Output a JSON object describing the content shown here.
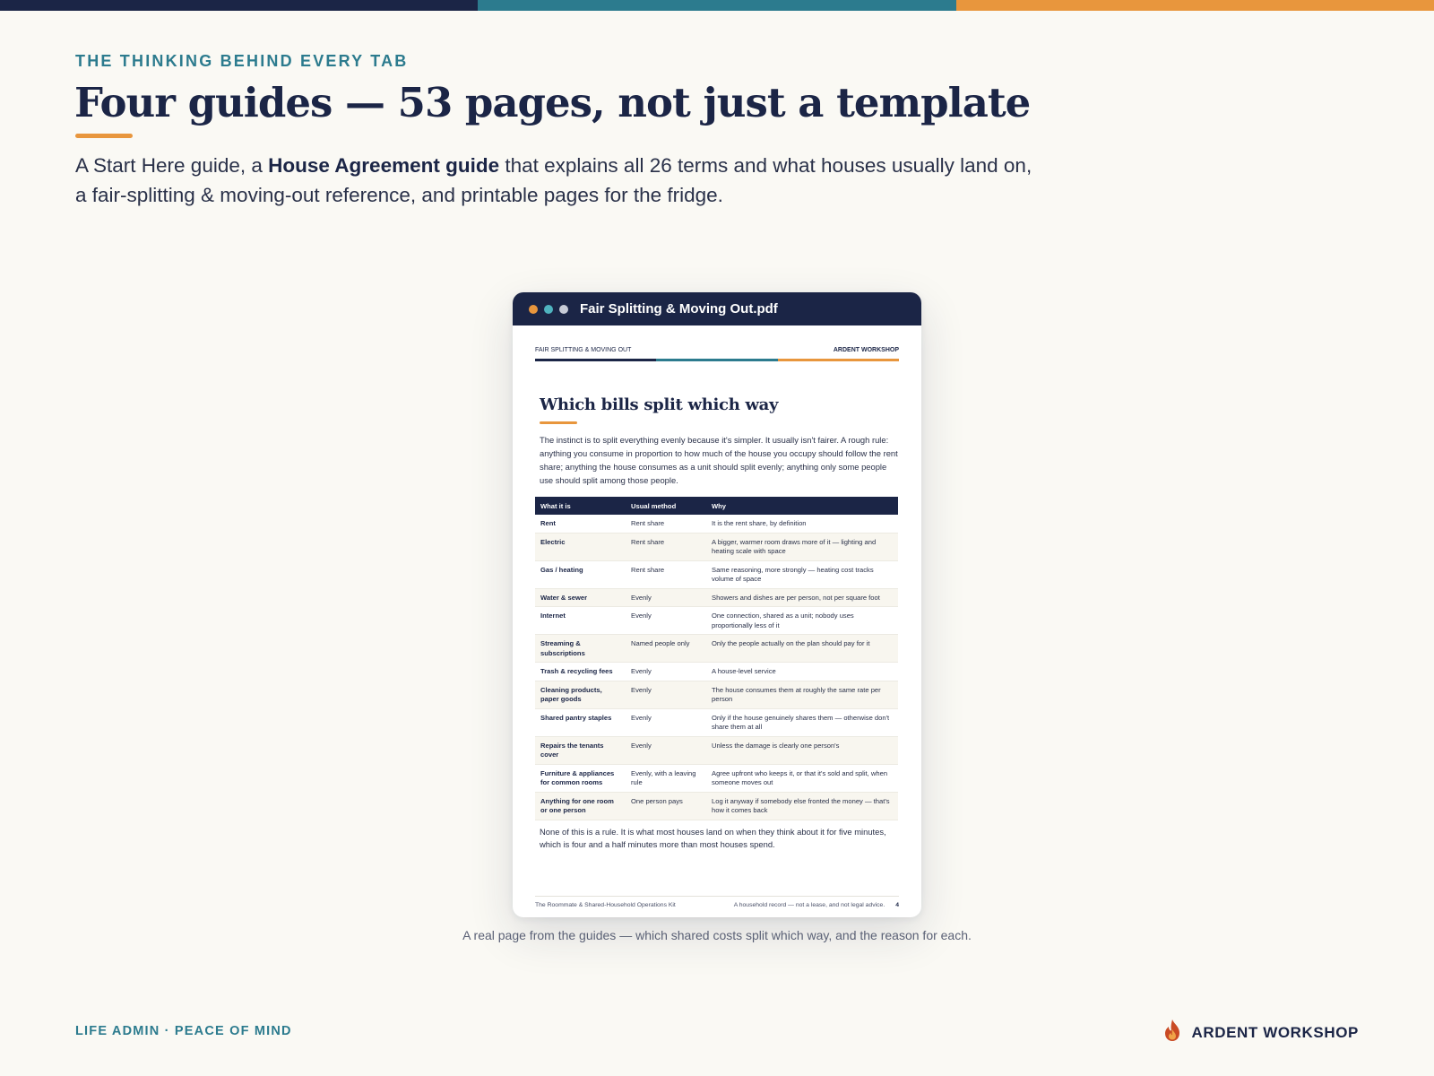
{
  "colors": {
    "navy": "#1b2546",
    "teal": "#2c7b8e",
    "orange": "#e8963d",
    "cream": "#faf9f4"
  },
  "header": {
    "eyebrow": "THE THINKING BEHIND EVERY TAB",
    "title": "Four guides — 53 pages, not just a template",
    "lede_before": "A Start Here guide, a ",
    "lede_bold": "House Agreement guide",
    "lede_after": " that explains all 26 terms and what houses usually land on, a fair-splitting & moving-out reference, and printable pages for the fridge."
  },
  "window": {
    "title": "Fair Splitting & Moving Out.pdf",
    "dot_colors": [
      "#e8963d",
      "#4fb3bf",
      "#c7cbd6"
    ]
  },
  "pdf": {
    "running_head_left": "FAIR SPLITTING & MOVING OUT",
    "running_head_right": "ARDENT WORKSHOP",
    "title": "Which bills split which way",
    "intro": "The instinct is to split everything evenly because it's simpler. It usually isn't fairer. A rough rule: anything you consume in proportion to how much of the house you occupy should follow the rent share; anything the house consumes as a unit should split evenly; anything only some people use should split among those people.",
    "columns": [
      "What it is",
      "Usual method",
      "Why"
    ],
    "rows": [
      {
        "item": "Rent",
        "method": "Rent share",
        "why": "It is the rent share, by definition"
      },
      {
        "item": "Electric",
        "method": "Rent share",
        "why": "A bigger, warmer room draws more of it — lighting and heating scale with space"
      },
      {
        "item": "Gas / heating",
        "method": "Rent share",
        "why": "Same reasoning, more strongly — heating cost tracks volume of space"
      },
      {
        "item": "Water & sewer",
        "method": "Evenly",
        "why": "Showers and dishes are per person, not per square foot"
      },
      {
        "item": "Internet",
        "method": "Evenly",
        "why": "One connection, shared as a unit; nobody uses proportionally less of it"
      },
      {
        "item": "Streaming & subscriptions",
        "method": "Named people only",
        "why": "Only the people actually on the plan should pay for it"
      },
      {
        "item": "Trash & recycling fees",
        "method": "Evenly",
        "why": "A house-level service"
      },
      {
        "item": "Cleaning products, paper goods",
        "method": "Evenly",
        "why": "The house consumes them at roughly the same rate per person"
      },
      {
        "item": "Shared pantry staples",
        "method": "Evenly",
        "why": "Only if the house genuinely shares them — otherwise don't share them at all"
      },
      {
        "item": "Repairs the tenants cover",
        "method": "Evenly",
        "why": "Unless the damage is clearly one person's"
      },
      {
        "item": "Furniture & appliances for common rooms",
        "method": "Evenly, with a leaving rule",
        "why": "Agree upfront who keeps it, or that it's sold and split, when someone moves out"
      },
      {
        "item": "Anything for one room or one person",
        "method": "One person pays",
        "why": "Log it anyway if somebody else fronted the money — that's how it comes back"
      }
    ],
    "outro": "None of this is a rule. It is what most houses land on when they think about it for five minutes, which is four and a half minutes more than most houses spend.",
    "footer_left": "The Roommate & Shared-Household Operations Kit",
    "footer_mid": "A household record — not a lease, and not legal advice.",
    "page_number": "4"
  },
  "caption": "A real page from the guides — which shared costs split which way, and the reason for each.",
  "footer": {
    "tagline": "LIFE ADMIN · PEACE OF MIND",
    "brand": "ARDENT WORKSHOP",
    "brand_icon": "flame-icon"
  }
}
